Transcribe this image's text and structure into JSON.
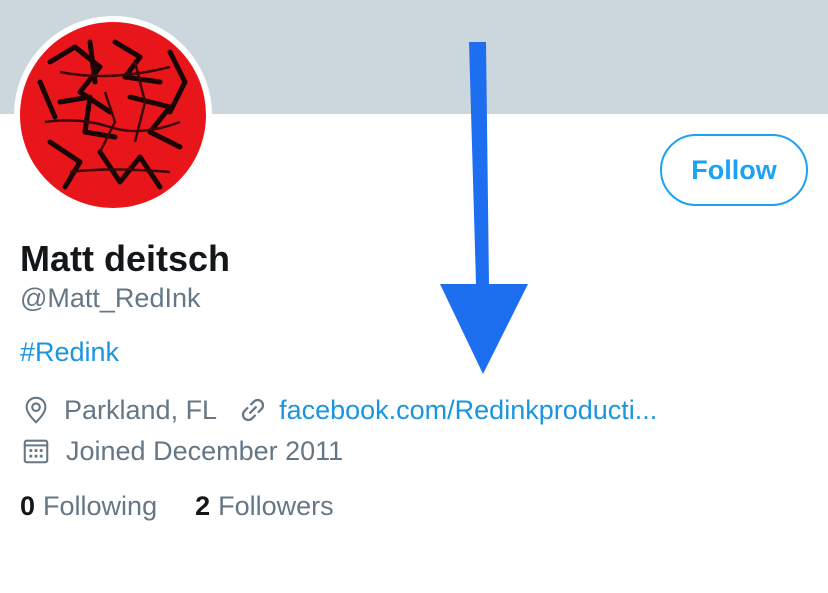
{
  "profile": {
    "name": "Matt deitsch",
    "handle": "@Matt_RedInk",
    "bio": "#Redink",
    "location": "Parkland, FL",
    "website": "facebook.com/Redinkproducti...",
    "joined": "Joined December 2011"
  },
  "actions": {
    "follow_label": "Follow"
  },
  "stats": {
    "following_count": "0",
    "following_label": "Following",
    "followers_count": "2",
    "followers_label": "Followers"
  },
  "colors": {
    "accent": "#1da1f2",
    "banner": "#ccd6dd",
    "secondary_text": "#657786",
    "annotation_arrow": "#1e6ff0",
    "avatar_red": "#e8161b"
  },
  "icons": {
    "location": "location-pin-icon",
    "website": "link-icon",
    "joined": "calendar-icon",
    "annotation": "down-arrow-icon"
  }
}
